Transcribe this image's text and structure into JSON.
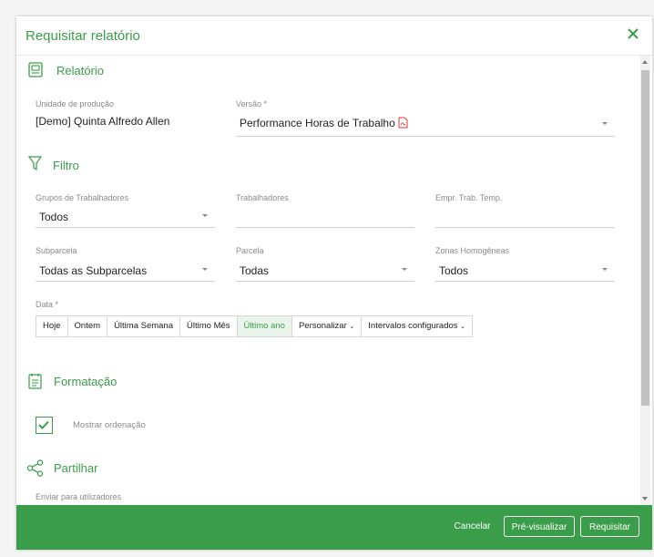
{
  "dialog": {
    "title": "Requisitar relatório"
  },
  "sections": {
    "report": {
      "title": "Relatório",
      "icon": "report-icon"
    },
    "filter": {
      "title": "Filtro",
      "icon": "funnel-icon"
    },
    "format": {
      "title": "Formatação",
      "icon": "document-lines-icon"
    },
    "share": {
      "title": "Partilhar",
      "icon": "share-icon"
    }
  },
  "report": {
    "unit_label": "Unidade de produção",
    "unit_value": "[Demo] Quinta Alfredo Allen",
    "version_label": "Versão *",
    "version_value": "Performance Horas de Trabalho",
    "version_icon": "pdf-icon"
  },
  "filter": {
    "worker_groups_label": "Grupos de Trabalhadores",
    "worker_groups_value": "Todos",
    "workers_label": "Trabalhadores",
    "workers_value": "",
    "temp_employer_label": "Empr. Trab. Temp.",
    "temp_employer_value": "",
    "subparcel_label": "Subparcela",
    "subparcel_value": "Todas as Subparcelas",
    "parcel_label": "Parcela",
    "parcel_value": "Todas",
    "zones_label": "Zonas Homogêneas",
    "zones_value": "Todos",
    "date_label": "Data *",
    "date_options": [
      "Hoje",
      "Ontem",
      "Última Semana",
      "Último Mês",
      "Último ano",
      "Personalizar",
      "Intervalos configurados"
    ],
    "date_selected": "Último ano"
  },
  "format": {
    "show_ordering_label": "Mostrar ordenação",
    "show_ordering_checked": true
  },
  "share": {
    "send_to_users_label": "Enviar para utilizadores"
  },
  "footer": {
    "cancel": "Cancelar",
    "preview": "Pré-visualizar",
    "request": "Requisitar"
  },
  "colors": {
    "accent": "#3a9d4a",
    "pdf": "#e53935"
  }
}
